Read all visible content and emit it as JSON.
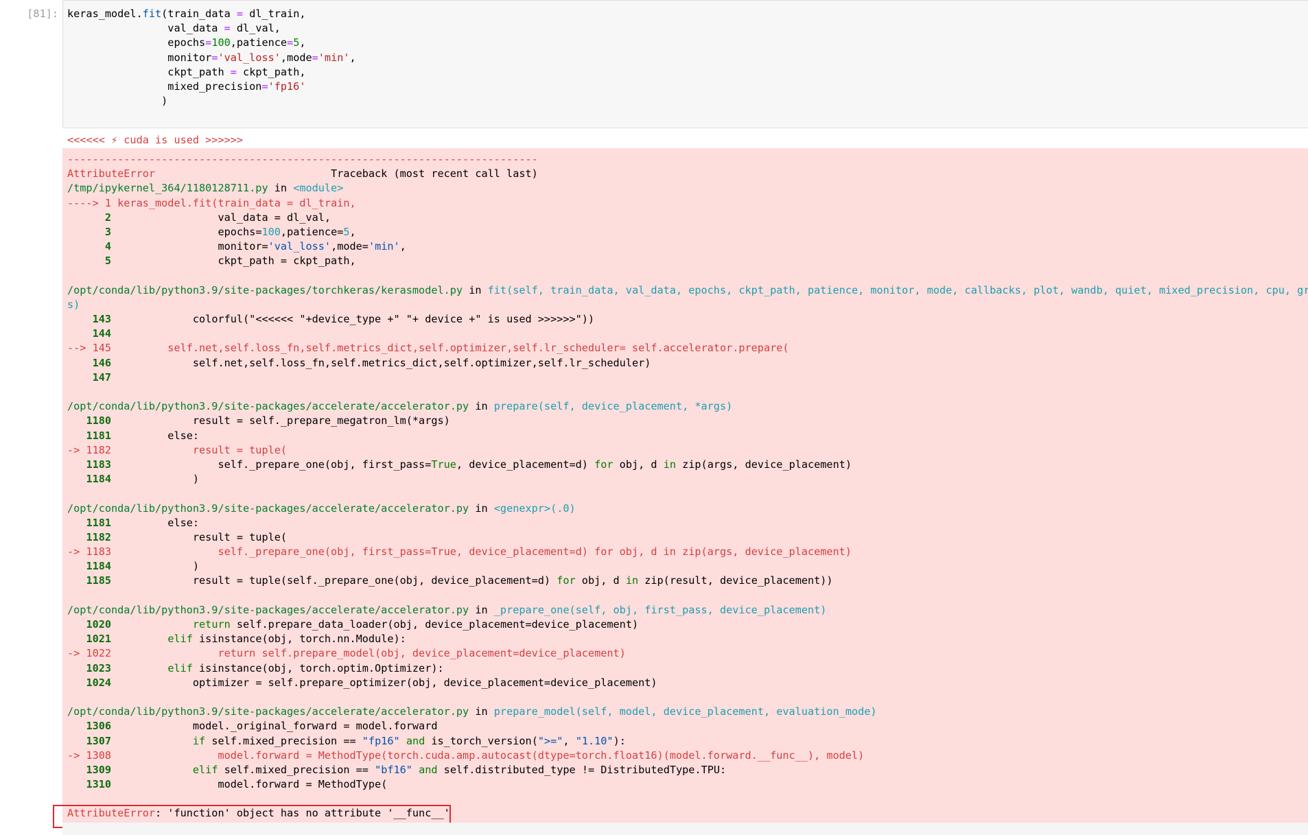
{
  "cell": {
    "prompt": "[81]:",
    "code_lines": [
      [
        [
          "keras_model.",
          ""
        ],
        [
          "fit",
          "nm"
        ],
        [
          "(train_data ",
          ""
        ],
        [
          "=",
          "op"
        ],
        [
          " dl_train,",
          ""
        ]
      ],
      [
        [
          "                val_data ",
          ""
        ],
        [
          "=",
          "op"
        ],
        [
          " dl_val,",
          ""
        ]
      ],
      [
        [
          "                epochs",
          ""
        ],
        [
          "=",
          "op"
        ],
        [
          "100",
          "kw"
        ],
        [
          ",patience",
          ""
        ],
        [
          "=",
          "op"
        ],
        [
          "5",
          "kw"
        ],
        [
          ",",
          ""
        ]
      ],
      [
        [
          "                monitor",
          ""
        ],
        [
          "=",
          "op"
        ],
        [
          "'val_loss'",
          "st"
        ],
        [
          ",mode",
          ""
        ],
        [
          "=",
          "op"
        ],
        [
          "'min'",
          "st"
        ],
        [
          ",",
          ""
        ]
      ],
      [
        [
          "                ckpt_path ",
          ""
        ],
        [
          "=",
          "op"
        ],
        [
          " ckpt_path,",
          ""
        ]
      ],
      [
        [
          "                mixed_precision",
          ""
        ],
        [
          "=",
          "op"
        ],
        [
          "'fp16'",
          "st"
        ]
      ],
      [
        [
          "               )",
          ""
        ]
      ]
    ]
  },
  "output": {
    "stderr_line": "<<<<<< ⚡ cuda is used >>>>>>",
    "traceback_lines": [
      [
        [
          "---------------------------------------------------------------------------",
          "rd"
        ]
      ],
      [
        [
          "AttributeError",
          "rd"
        ],
        [
          "                            Traceback (most recent call last)",
          ""
        ]
      ],
      [
        [
          "/tmp/ipykernel_364/1180128711.py",
          "gr"
        ],
        [
          " in ",
          ""
        ],
        [
          "<module>",
          "lk"
        ]
      ],
      [
        [
          "----> 1 keras_model.fit(train_data = dl_train,",
          "rd"
        ]
      ],
      [
        [
          "      ",
          ""
        ],
        [
          "2",
          "ln"
        ],
        [
          "                 val_data = dl_val,",
          ""
        ]
      ],
      [
        [
          "      ",
          ""
        ],
        [
          "3",
          "ln"
        ],
        [
          "                 epochs=",
          ""
        ],
        [
          "100",
          "cy"
        ],
        [
          ",patience=",
          ""
        ],
        [
          "5",
          "cy"
        ],
        [
          ",",
          ""
        ]
      ],
      [
        [
          "      ",
          ""
        ],
        [
          "4",
          "ln"
        ],
        [
          "                 monitor=",
          ""
        ],
        [
          "'val_loss'",
          "nm"
        ],
        [
          ",mode=",
          ""
        ],
        [
          "'min'",
          "nm"
        ],
        [
          ",",
          ""
        ]
      ],
      [
        [
          "      ",
          ""
        ],
        [
          "5",
          "ln"
        ],
        [
          "                 ckpt_path = ckpt_path,",
          ""
        ]
      ],
      [
        [
          "",
          ""
        ]
      ],
      [
        [
          "/opt/conda/lib/python3.9/site-packages/torchkeras/kerasmodel.py",
          "gr"
        ],
        [
          " in ",
          ""
        ],
        [
          "fit(self, train_data, val_data, epochs, ckpt_path, patience, monitor, mode, callbacks, plot, wandb, quiet, mixed_precision, cpu, gradien",
          "lk"
        ]
      ],
      [
        [
          "s)",
          "lk"
        ]
      ],
      [
        [
          "    ",
          ""
        ],
        [
          "143",
          "ln"
        ],
        [
          "             colorful(\"<<<<<< \"+device_type +\" \"+ device +\" is used >>>>>>\"))",
          ""
        ]
      ],
      [
        [
          "    ",
          ""
        ],
        [
          "144",
          "ln"
        ]
      ],
      [
        [
          "--> 145         self.net,self.loss_fn,self.metrics_dict,self.optimizer,self.lr_scheduler= self.accelerator.prepare(",
          "rd"
        ]
      ],
      [
        [
          "    ",
          ""
        ],
        [
          "146",
          "ln"
        ],
        [
          "             self.net,self.loss_fn,self.metrics_dict,self.optimizer,self.lr_scheduler)",
          ""
        ]
      ],
      [
        [
          "    ",
          ""
        ],
        [
          "147",
          "ln"
        ]
      ],
      [
        [
          "",
          ""
        ]
      ],
      [
        [
          "/opt/conda/lib/python3.9/site-packages/accelerate/accelerator.py",
          "gr"
        ],
        [
          " in ",
          ""
        ],
        [
          "prepare(self, device_placement, *args)",
          "lk"
        ]
      ],
      [
        [
          "   ",
          ""
        ],
        [
          "1180",
          "ln"
        ],
        [
          "             result = self._prepare_megatron_lm(*args)",
          ""
        ]
      ],
      [
        [
          "   ",
          ""
        ],
        [
          "1181",
          "ln"
        ],
        [
          "         else:",
          ""
        ]
      ],
      [
        [
          "-> 1182             result = tuple(",
          "rd"
        ]
      ],
      [
        [
          "   ",
          ""
        ],
        [
          "1183",
          "ln"
        ],
        [
          "                 self._prepare_one(obj, first_pass=",
          ""
        ],
        [
          "True",
          "kw"
        ],
        [
          ", device_placement=d) ",
          ""
        ],
        [
          "for",
          "kw"
        ],
        [
          " obj, d ",
          ""
        ],
        [
          "in",
          "kw"
        ],
        [
          " zip(args, device_placement)",
          ""
        ]
      ],
      [
        [
          "   ",
          ""
        ],
        [
          "1184",
          "ln"
        ],
        [
          "             )",
          ""
        ]
      ],
      [
        [
          "",
          ""
        ]
      ],
      [
        [
          "/opt/conda/lib/python3.9/site-packages/accelerate/accelerator.py",
          "gr"
        ],
        [
          " in ",
          ""
        ],
        [
          "<genexpr>(.0)",
          "lk"
        ]
      ],
      [
        [
          "   ",
          ""
        ],
        [
          "1181",
          "ln"
        ],
        [
          "         else:",
          ""
        ]
      ],
      [
        [
          "   ",
          ""
        ],
        [
          "1182",
          "ln"
        ],
        [
          "             result = tuple(",
          ""
        ]
      ],
      [
        [
          "-> 1183                 self._prepare_one(obj, first_pass=True, device_placement=d) for obj, d in zip(args, device_placement)",
          "rd"
        ]
      ],
      [
        [
          "   ",
          ""
        ],
        [
          "1184",
          "ln"
        ],
        [
          "             )",
          ""
        ]
      ],
      [
        [
          "   ",
          ""
        ],
        [
          "1185",
          "ln"
        ],
        [
          "             result = tuple(self._prepare_one(obj, device_placement=d) ",
          ""
        ],
        [
          "for",
          "kw"
        ],
        [
          " obj, d ",
          ""
        ],
        [
          "in",
          "kw"
        ],
        [
          " zip(result, device_placement))",
          ""
        ]
      ],
      [
        [
          "",
          ""
        ]
      ],
      [
        [
          "/opt/conda/lib/python3.9/site-packages/accelerate/accelerator.py",
          "gr"
        ],
        [
          " in ",
          ""
        ],
        [
          "_prepare_one(self, obj, first_pass, device_placement)",
          "lk"
        ]
      ],
      [
        [
          "   ",
          ""
        ],
        [
          "1020",
          "ln"
        ],
        [
          "             ",
          ""
        ],
        [
          "return",
          "kw"
        ],
        [
          " self.prepare_data_loader(obj, device_placement=device_placement)",
          ""
        ]
      ],
      [
        [
          "   ",
          ""
        ],
        [
          "1021",
          "ln"
        ],
        [
          "         ",
          ""
        ],
        [
          "elif",
          "kw"
        ],
        [
          " isinstance(obj, torch.nn.Module):",
          ""
        ]
      ],
      [
        [
          "-> 1022                 return self.prepare_model(obj, device_placement=device_placement)",
          "rd"
        ]
      ],
      [
        [
          "   ",
          ""
        ],
        [
          "1023",
          "ln"
        ],
        [
          "         ",
          ""
        ],
        [
          "elif",
          "kw"
        ],
        [
          " isinstance(obj, torch.optim.Optimizer):",
          ""
        ]
      ],
      [
        [
          "   ",
          ""
        ],
        [
          "1024",
          "ln"
        ],
        [
          "             optimizer = self.prepare_optimizer(obj, device_placement=device_placement)",
          ""
        ]
      ],
      [
        [
          "",
          ""
        ]
      ],
      [
        [
          "/opt/conda/lib/python3.9/site-packages/accelerate/accelerator.py",
          "gr"
        ],
        [
          " in ",
          ""
        ],
        [
          "prepare_model(self, model, device_placement, evaluation_mode)",
          "lk"
        ]
      ],
      [
        [
          "   ",
          ""
        ],
        [
          "1306",
          "ln"
        ],
        [
          "             model._original_forward = model.forward",
          ""
        ]
      ],
      [
        [
          "   ",
          ""
        ],
        [
          "1307",
          "ln"
        ],
        [
          "             ",
          ""
        ],
        [
          "if",
          "kw"
        ],
        [
          " self.mixed_precision == ",
          ""
        ],
        [
          "\"fp16\"",
          "nm"
        ],
        [
          " ",
          ""
        ],
        [
          "and",
          "kw"
        ],
        [
          " is_torch_version(",
          ""
        ],
        [
          "\">=\"",
          "nm"
        ],
        [
          ", ",
          ""
        ],
        [
          "\"1.10\"",
          "nm"
        ],
        [
          "):",
          ""
        ]
      ],
      [
        [
          "-> 1308                 model.forward = MethodType(torch.cuda.amp.autocast(dtype=torch.float16)(model.forward.__func__), model)",
          "rd"
        ]
      ],
      [
        [
          "   ",
          ""
        ],
        [
          "1309",
          "ln"
        ],
        [
          "             ",
          ""
        ],
        [
          "elif",
          "kw"
        ],
        [
          " self.mixed_precision == ",
          ""
        ],
        [
          "\"bf16\"",
          "nm"
        ],
        [
          " ",
          ""
        ],
        [
          "and",
          "kw"
        ],
        [
          " self.distributed_type != DistributedType.TPU:",
          ""
        ]
      ],
      [
        [
          "   ",
          ""
        ],
        [
          "1310",
          "ln"
        ],
        [
          "                 model.forward = MethodType(",
          ""
        ]
      ],
      [
        [
          "",
          ""
        ]
      ],
      [
        [
          "AttributeError",
          "rd"
        ],
        [
          ": 'function' object has no attribute '__func__'",
          ""
        ]
      ]
    ]
  },
  "colors": {
    "error_background": "#fedddd",
    "highlight_box": "#e0282e",
    "line_number": "#0d6e0d",
    "path_green": "#00802a",
    "link_cyan": "#1aa0b0",
    "error_red": "#d4403f"
  }
}
